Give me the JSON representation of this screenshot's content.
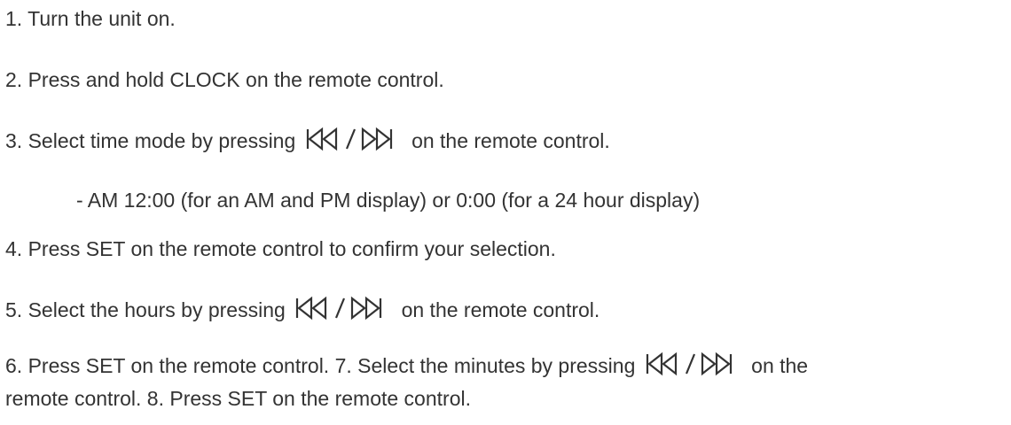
{
  "instructions": {
    "step1": "1. Turn the unit on.",
    "step2": "2. Press and hold CLOCK on the remote control.",
    "step3_before": "3. Select time mode by pressing",
    "step3_after": "on the remote control.",
    "step3_note": "- AM 12:00 (for an AM and PM display) or 0:00 (for a 24 hour display)",
    "step4": "4. Press SET on the remote control to confirm your selection.",
    "step5_before": "5. Select the hours by pressing",
    "step5_after": "on the remote control.",
    "step6_before": "6. Press SET on the remote control. 7. Select the minutes by pressing",
    "step6_after": "on the",
    "step6_cont": "remote control. 8. Press SET on the remote control."
  },
  "icons": {
    "skip_buttons": "skip-back-forward-icon"
  },
  "colors": {
    "text": "#333333",
    "background": "#ffffff"
  }
}
